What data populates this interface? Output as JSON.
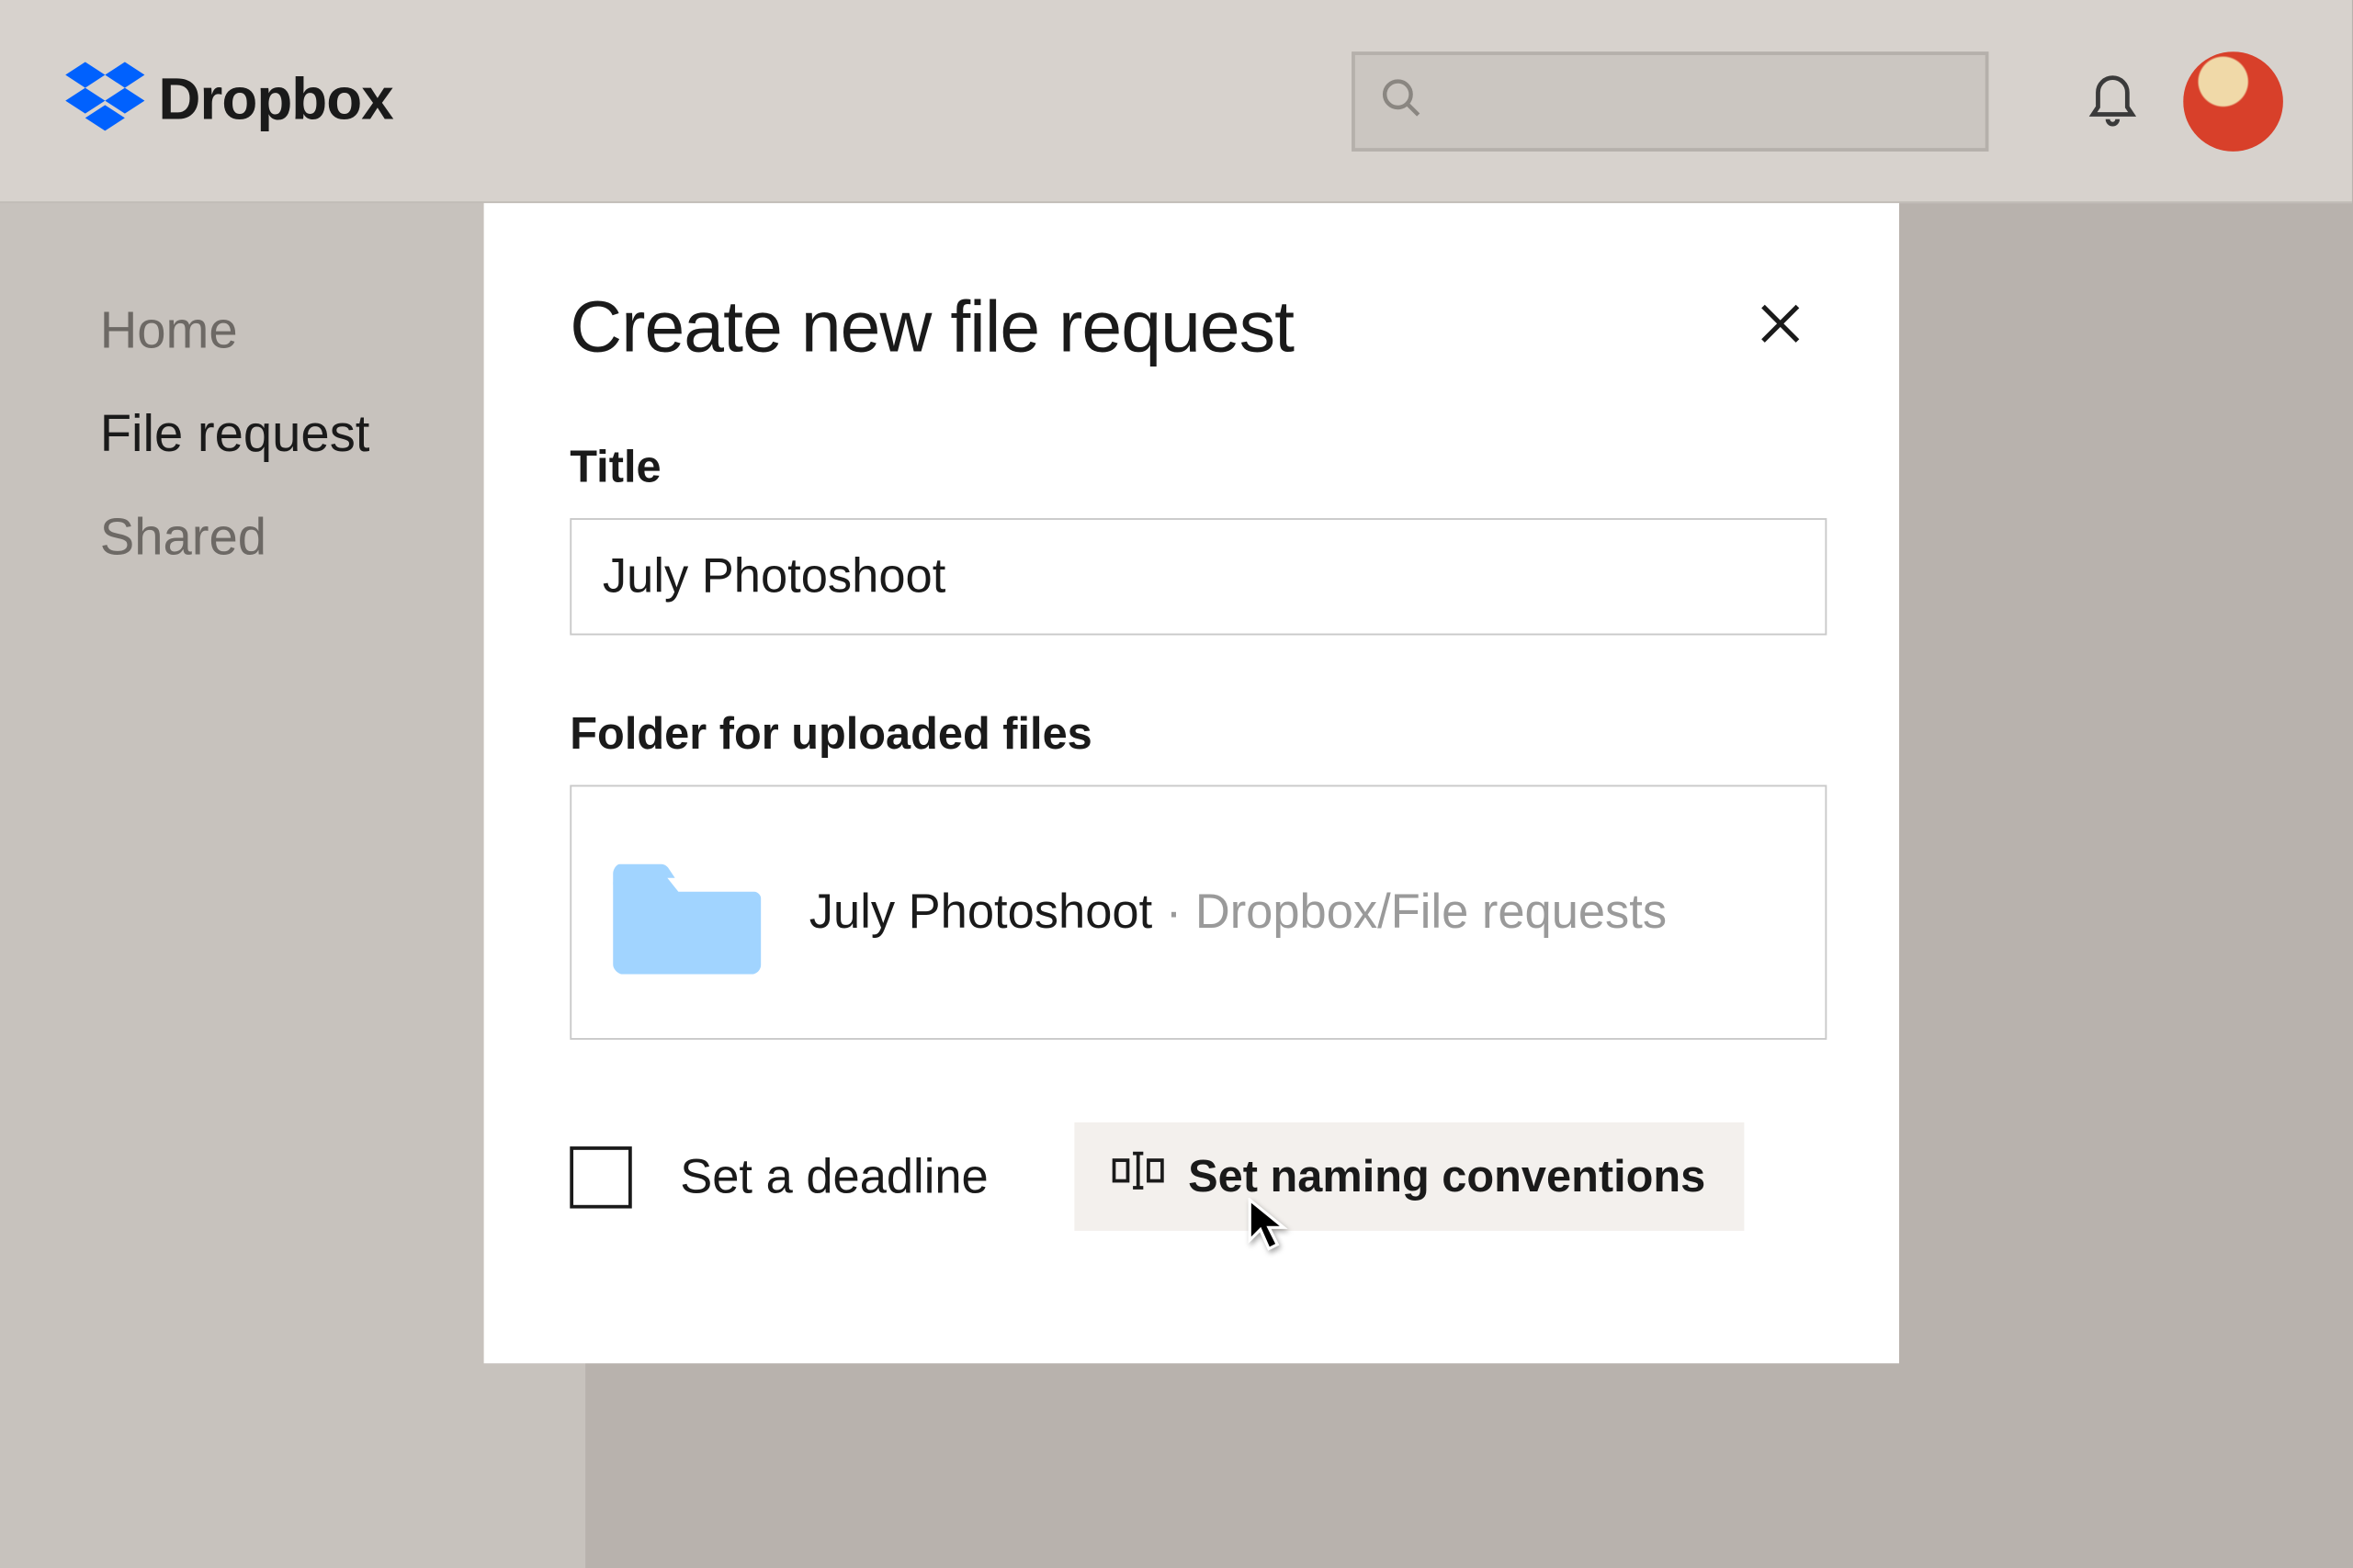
{
  "header": {
    "brand": "Dropbox",
    "search_placeholder": ""
  },
  "sidebar": {
    "items": [
      {
        "label": "Home",
        "active": false
      },
      {
        "label": "File request",
        "active": true
      },
      {
        "label": "Shared",
        "active": false
      }
    ]
  },
  "modal": {
    "title": "Create new file request",
    "title_label": "Title",
    "title_value": "July Photoshoot",
    "folder_label": "Folder for uploaded files",
    "folder_name": "July Photoshoot",
    "folder_separator": " · ",
    "folder_path": "Dropbox/File requests",
    "deadline_label": "Set a deadline",
    "naming_label": "Set naming conventions"
  },
  "colors": {
    "accent_blue": "#0061fe",
    "folder_blue": "#A1D4FF"
  }
}
